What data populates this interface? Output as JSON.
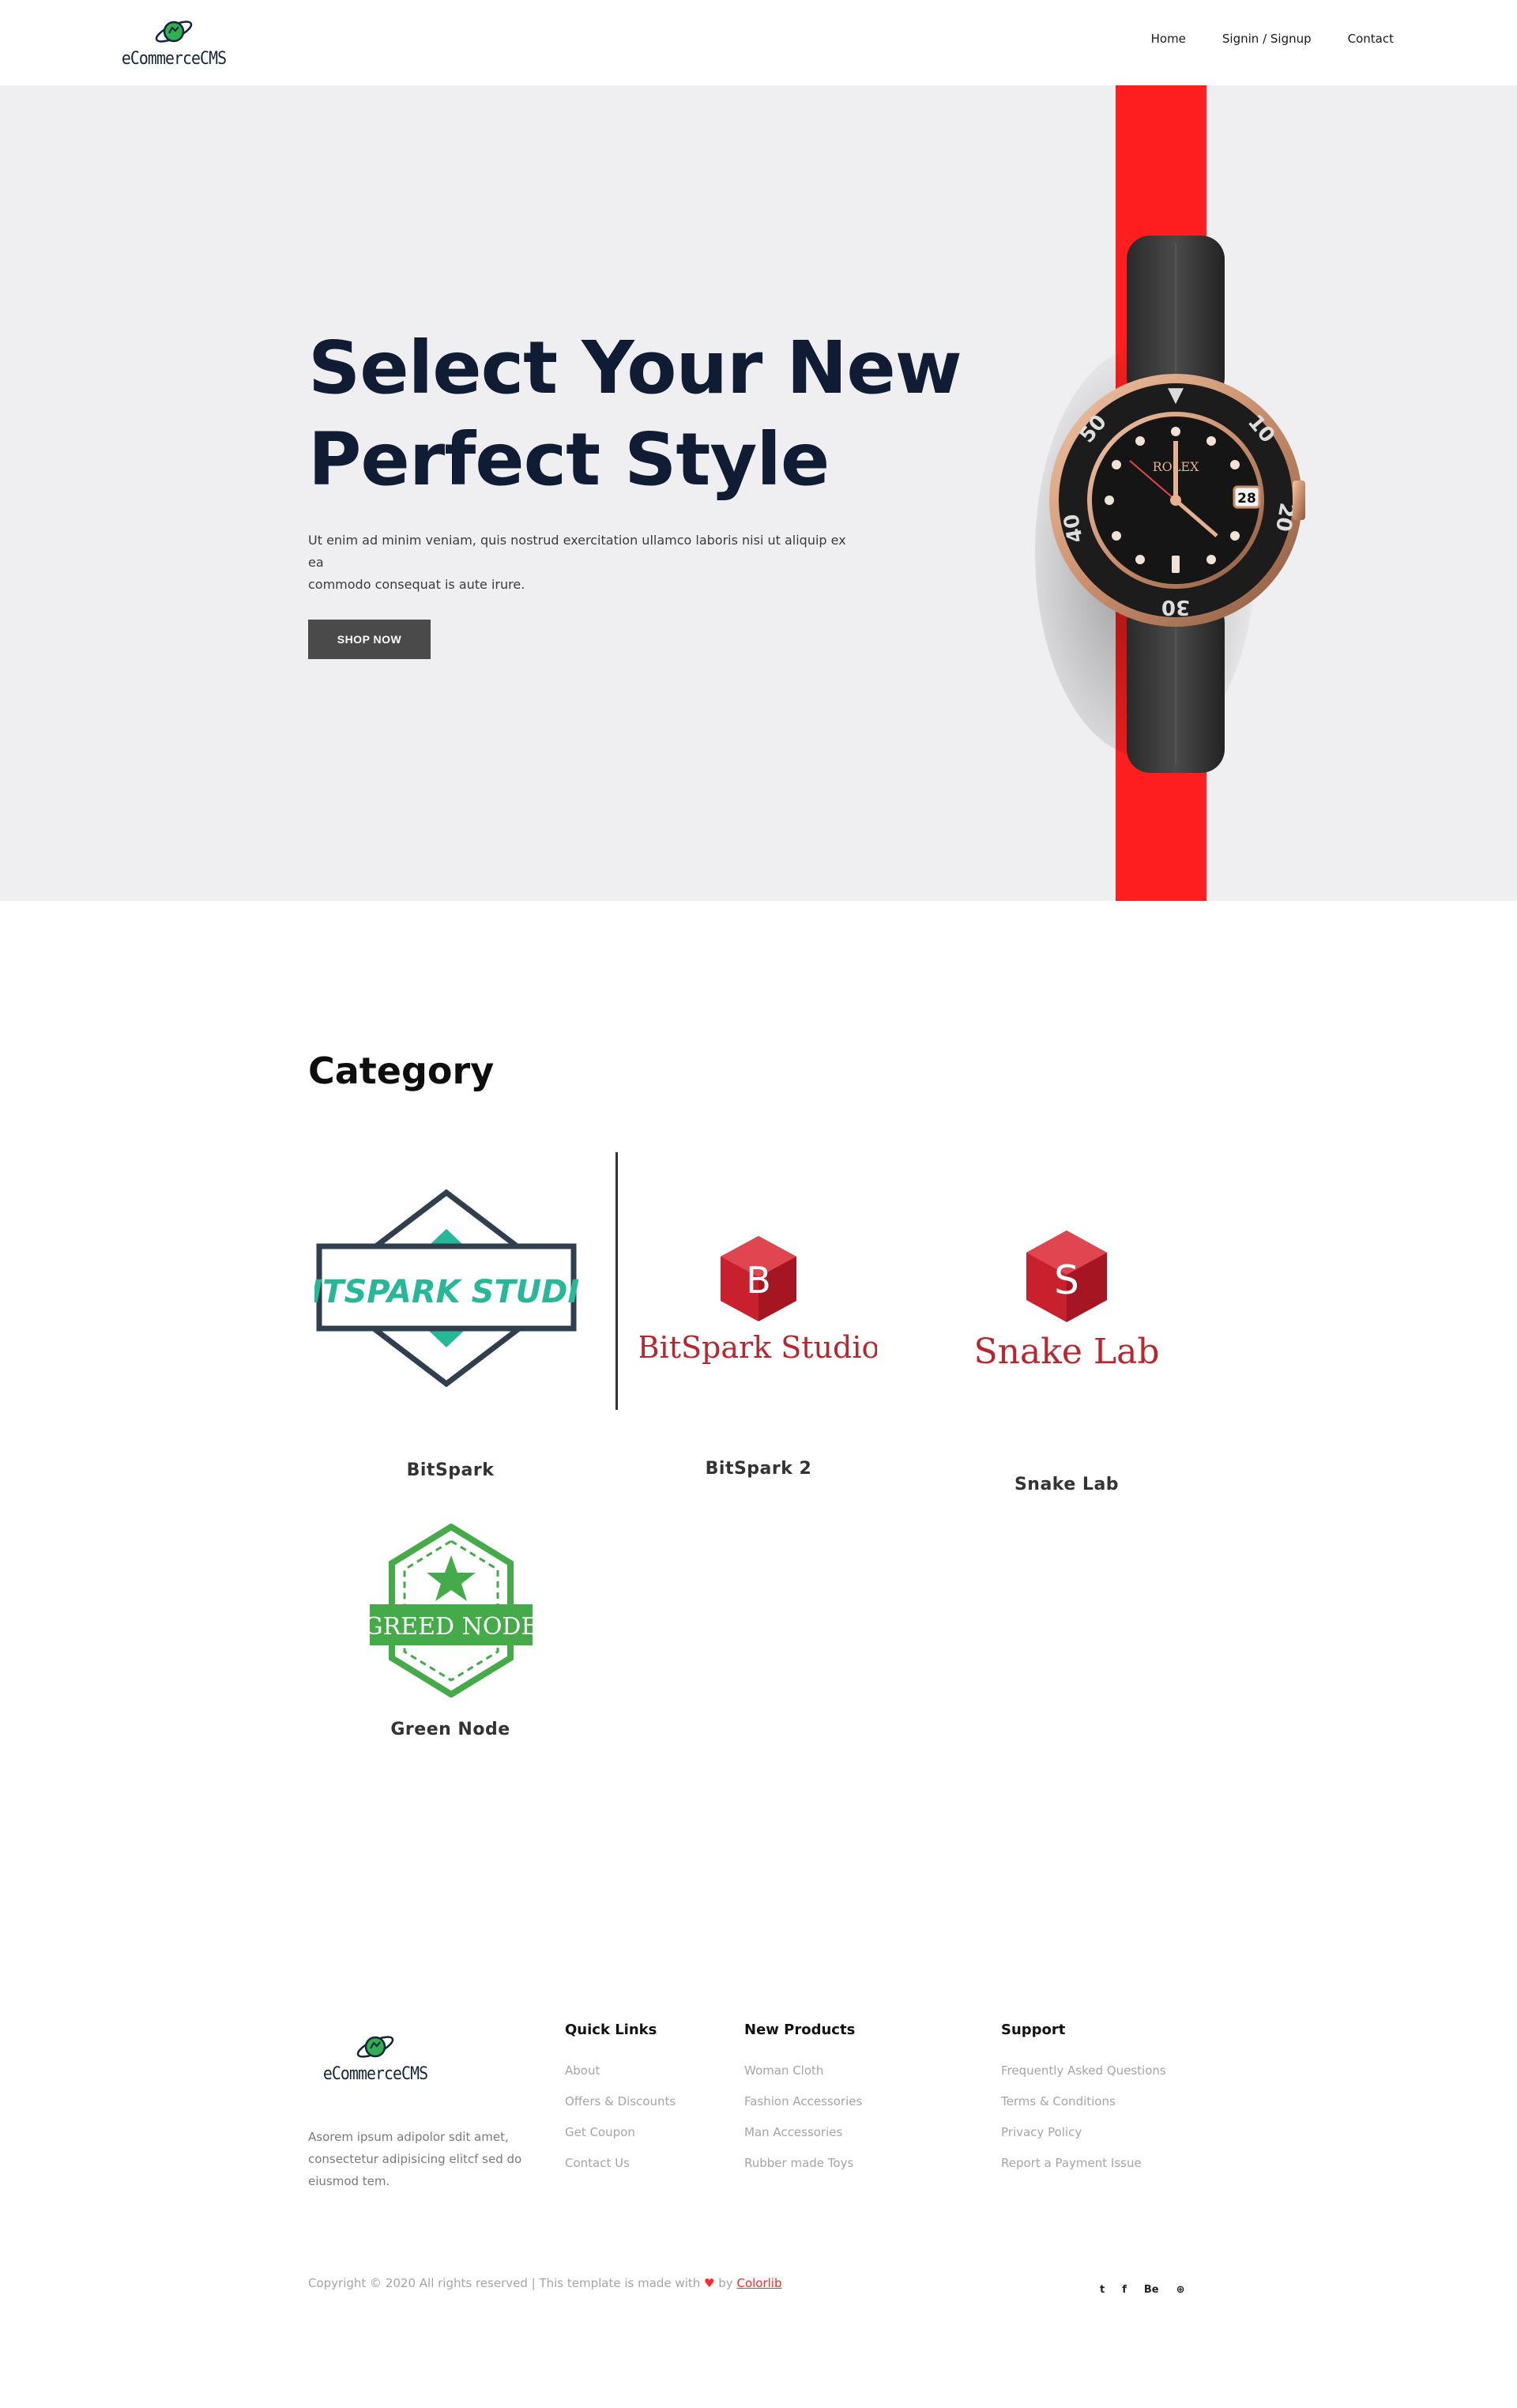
{
  "header": {
    "brand": "eCommerceCMS",
    "nav": [
      "Home",
      "Signin / Signup",
      "Contact"
    ]
  },
  "hero": {
    "title_line1": "Select Your New",
    "title_line2": "Perfect Style",
    "text_line1": "Ut enim ad minim veniam, quis nostrud exercitation ullamco laboris nisi ut aliquip ex ea",
    "text_line2": "commodo consequat is aute irure.",
    "button": "SHOP NOW",
    "accent": "#ff1f1f",
    "watch_brand": "ROLEX",
    "watch_date": "28"
  },
  "category": {
    "title": "Category",
    "items": [
      {
        "name": "BitSpark",
        "logo_text": "BITSPARK STUDIO"
      },
      {
        "name": "BitSpark 2",
        "logo_text": "BitSpark Studio",
        "logo_letter": "B"
      },
      {
        "name": "Snake Lab",
        "logo_text": "Snake Lab",
        "logo_letter": "S"
      },
      {
        "name": "Green Node",
        "logo_text": "GREED NODE"
      }
    ]
  },
  "footer": {
    "brand": "eCommerceCMS",
    "about_line1": "Asorem ipsum adipolor sdit amet,",
    "about_line2": "consectetur adipisicing elitcf sed do",
    "about_line3": "eiusmod tem.",
    "columns": [
      {
        "title": "Quick Links",
        "links": [
          "About",
          "Offers & Discounts",
          "Get Coupon",
          "Contact Us"
        ]
      },
      {
        "title": "New Products",
        "links": [
          "Woman Cloth",
          "Fashion Accessories",
          "Man Accessories",
          "Rubber made Toys"
        ]
      },
      {
        "title": "Support",
        "links": [
          "Frequently Asked Questions",
          "Terms & Conditions",
          "Privacy Policy",
          "Report a Payment Issue"
        ]
      }
    ],
    "copyright_pre": "Copyright © 2020 All rights reserved | This template is made with",
    "copyright_by": "by",
    "copyright_brand": "Colorlib",
    "socials": [
      "twitter-icon",
      "facebook-icon",
      "behance-icon",
      "globe-icon"
    ],
    "social_labels": {
      "twitter": "t",
      "facebook": "f",
      "behance": "Be",
      "globe": "⊕"
    }
  }
}
